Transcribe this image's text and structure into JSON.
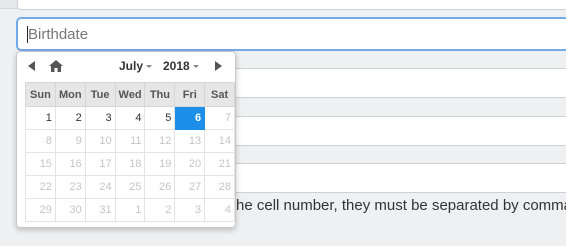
{
  "form": {
    "birthdate_placeholder": "Birthdate",
    "help_text": "he cell number, they must be separated by comma"
  },
  "datepicker": {
    "month": "July",
    "year": "2018",
    "weekdays": [
      "Sun",
      "Mon",
      "Tue",
      "Wed",
      "Thu",
      "Fri",
      "Sat"
    ],
    "weeks": [
      [
        {
          "d": "1"
        },
        {
          "d": "2"
        },
        {
          "d": "3"
        },
        {
          "d": "4"
        },
        {
          "d": "5"
        },
        {
          "d": "6",
          "today": true
        },
        {
          "d": "7",
          "other": true
        }
      ],
      [
        {
          "d": "8",
          "other": true
        },
        {
          "d": "9",
          "other": true
        },
        {
          "d": "10",
          "other": true
        },
        {
          "d": "11",
          "other": true
        },
        {
          "d": "12",
          "other": true
        },
        {
          "d": "13",
          "other": true
        },
        {
          "d": "14",
          "other": true
        }
      ],
      [
        {
          "d": "15",
          "other": true
        },
        {
          "d": "16",
          "other": true
        },
        {
          "d": "17",
          "other": true
        },
        {
          "d": "18",
          "other": true
        },
        {
          "d": "19",
          "other": true
        },
        {
          "d": "20",
          "other": true
        },
        {
          "d": "21",
          "other": true
        }
      ],
      [
        {
          "d": "22",
          "other": true
        },
        {
          "d": "23",
          "other": true
        },
        {
          "d": "24",
          "other": true
        },
        {
          "d": "25",
          "other": true
        },
        {
          "d": "26",
          "other": true
        },
        {
          "d": "27",
          "other": true
        },
        {
          "d": "28",
          "other": true
        }
      ],
      [
        {
          "d": "29",
          "other": true
        },
        {
          "d": "30",
          "other": true
        },
        {
          "d": "31",
          "other": true
        },
        {
          "d": "1",
          "other": true
        },
        {
          "d": "2",
          "other": true
        },
        {
          "d": "3",
          "other": true
        },
        {
          "d": "4",
          "other": true
        }
      ]
    ],
    "icons": {
      "prev": "arrow-left-icon",
      "home": "home-icon",
      "next": "arrow-right-icon"
    },
    "accent_color": "#1d8fe8"
  }
}
